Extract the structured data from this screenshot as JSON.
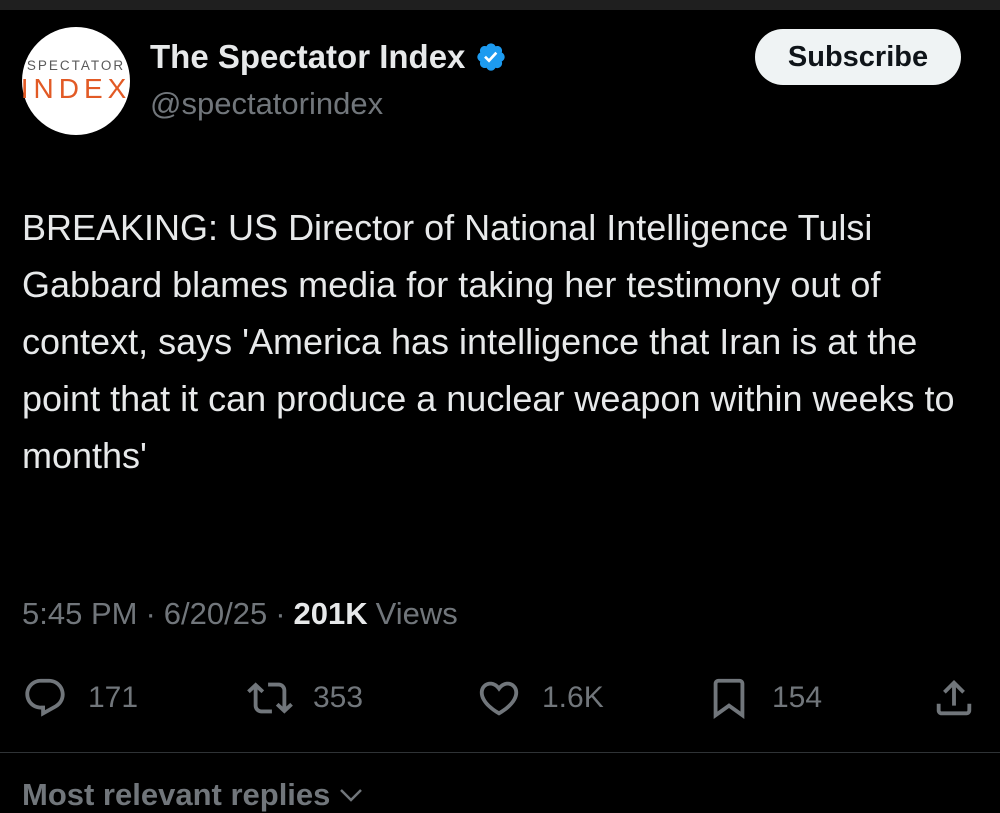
{
  "author": {
    "avatar": {
      "line1": "SPECTATOR",
      "line2": "INDEX"
    },
    "name": "The Spectator Index",
    "handle": "@spectatorindex",
    "verified_icon": "verified-badge-icon"
  },
  "subscribe_label": "Subscribe",
  "tweet": {
    "text": "BREAKING: US Director of National Intelligence Tulsi Gabbard blames media for taking her testimony out of context, says 'America has intelligence that Iran is at the point that it can produce a nuclear weapon within weeks to months'",
    "time": "5:45 PM",
    "date": "6/20/25",
    "separator": "·",
    "views_count": "201K",
    "views_label": "Views"
  },
  "actions": {
    "replies": {
      "icon": "reply-icon",
      "count": "171"
    },
    "reposts": {
      "icon": "repost-icon",
      "count": "353"
    },
    "likes": {
      "icon": "heart-icon",
      "count": "1.6K"
    },
    "bookmarks": {
      "icon": "bookmark-icon",
      "count": "154"
    },
    "share": {
      "icon": "share-icon"
    }
  },
  "replies_sort": {
    "label": "Most relevant replies",
    "icon": "chevron-down-icon"
  },
  "colors": {
    "background": "#000000",
    "text_primary": "#e7e9ea",
    "text_secondary": "#71767b",
    "verified": "#1d9bf0",
    "brand_orange": "#e25a25",
    "button_bg": "#eff3f4"
  }
}
